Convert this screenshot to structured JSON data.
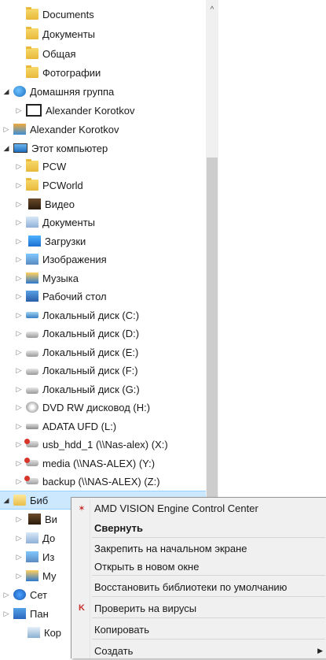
{
  "tree": {
    "rows": [
      {
        "label": "Documents",
        "exp": "",
        "icon": "folder-icon"
      },
      {
        "label": "Документы",
        "exp": "",
        "icon": "folder-icon"
      },
      {
        "label": "Общая",
        "exp": "",
        "icon": "folder-icon"
      },
      {
        "label": "Фотографии",
        "exp": "",
        "icon": "folder-icon"
      },
      {
        "label": "Домашняя группа",
        "exp": "◢",
        "icon": "homegroup-icon"
      },
      {
        "label": "Alexander Korotkov",
        "exp": "▷",
        "icon": "user-icon"
      },
      {
        "label": "Alexander Korotkov",
        "exp": "▷",
        "icon": "user-folder-icon"
      },
      {
        "label": "Этот компьютер",
        "exp": "◢",
        "icon": "computer-icon"
      },
      {
        "label": "PCW",
        "exp": "▷",
        "icon": "folder-icon"
      },
      {
        "label": "PCWorld",
        "exp": "▷",
        "icon": "folder-icon"
      },
      {
        "label": "Видео",
        "exp": "▷",
        "icon": "video-icon"
      },
      {
        "label": "Документы",
        "exp": "▷",
        "icon": "documents-icon"
      },
      {
        "label": "Загрузки",
        "exp": "▷",
        "icon": "downloads-icon"
      },
      {
        "label": "Изображения",
        "exp": "▷",
        "icon": "pictures-icon"
      },
      {
        "label": "Музыка",
        "exp": "▷",
        "icon": "music-icon"
      },
      {
        "label": "Рабочий стол",
        "exp": "▷",
        "icon": "desktop-icon"
      },
      {
        "label": "Локальный диск (C:)",
        "exp": "▷",
        "icon": "drive-c-icon"
      },
      {
        "label": "Локальный диск (D:)",
        "exp": "▷",
        "icon": "drive-icon"
      },
      {
        "label": "Локальный диск (E:)",
        "exp": "▷",
        "icon": "drive-icon"
      },
      {
        "label": "Локальный диск (F:)",
        "exp": "▷",
        "icon": "drive-icon"
      },
      {
        "label": "Локальный диск (G:)",
        "exp": "▷",
        "icon": "drive-icon"
      },
      {
        "label": "DVD RW дисковод (H:)",
        "exp": "▷",
        "icon": "dvd-icon"
      },
      {
        "label": "ADATA UFD (L:)",
        "exp": "▷",
        "icon": "usb-drive-icon"
      },
      {
        "label": "usb_hdd_1 (\\\\Nas-alex) (X:)",
        "exp": "▷",
        "icon": "network-drive-icon"
      },
      {
        "label": "media (\\\\NAS-ALEX) (Y:)",
        "exp": "▷",
        "icon": "network-drive-icon"
      },
      {
        "label": "backup (\\\\NAS-ALEX) (Z:)",
        "exp": "▷",
        "icon": "network-drive-icon"
      },
      {
        "label": "Биб",
        "exp": "◢",
        "icon": "libraries-icon"
      },
      {
        "label": "Ви",
        "exp": "▷",
        "icon": "video-library-icon"
      },
      {
        "label": "До",
        "exp": "▷",
        "icon": "documents-library-icon"
      },
      {
        "label": "Из",
        "exp": "▷",
        "icon": "pictures-library-icon"
      },
      {
        "label": "Му",
        "exp": "▷",
        "icon": "music-library-icon"
      },
      {
        "label": "Сет",
        "exp": "▷",
        "icon": "network-icon"
      },
      {
        "label": "Пан",
        "exp": "▷",
        "icon": "control-panel-icon"
      },
      {
        "label": "Кор",
        "exp": "",
        "icon": "recycle-bin-icon"
      }
    ]
  },
  "context_menu": {
    "items": [
      {
        "label": "AMD VISION Engine Control Center",
        "icon": "amd-icon",
        "bold": false,
        "submenu": false
      },
      {
        "label": "Свернуть",
        "icon": "",
        "bold": true,
        "submenu": false
      },
      {
        "label": "Закрепить на начальном экране",
        "icon": "",
        "bold": false,
        "submenu": false
      },
      {
        "label": "Открыть в новом окне",
        "icon": "",
        "bold": false,
        "submenu": false
      },
      {
        "label": "Восстановить библиотеки по умолчанию",
        "icon": "",
        "bold": false,
        "submenu": false
      },
      {
        "label": "Проверить на вирусы",
        "icon": "kaspersky-icon",
        "bold": false,
        "submenu": false
      },
      {
        "label": "Копировать",
        "icon": "",
        "bold": false,
        "submenu": false
      },
      {
        "label": "Создать",
        "icon": "",
        "bold": false,
        "submenu": true
      }
    ]
  }
}
